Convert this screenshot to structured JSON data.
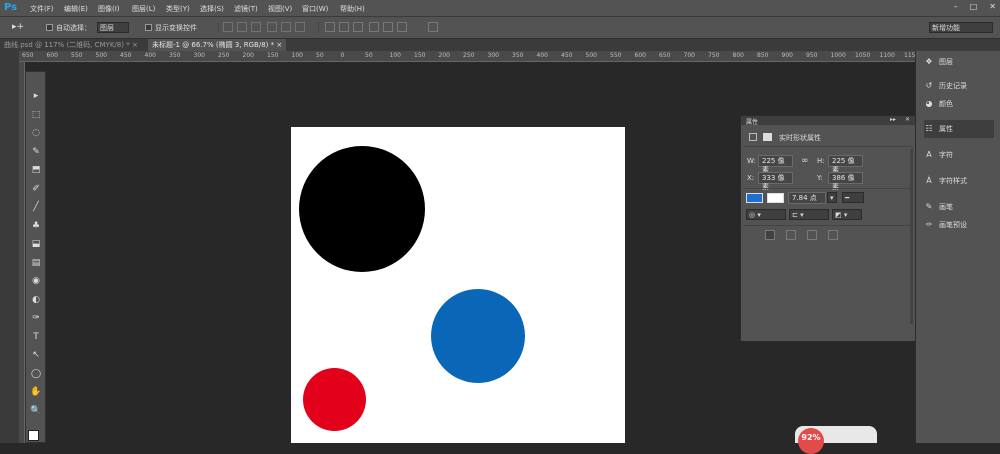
{
  "app": {
    "logo": "Ps"
  },
  "menu": [
    "文件(F)",
    "编辑(E)",
    "图像(I)",
    "图层(L)",
    "类型(Y)",
    "选择(S)",
    "滤镜(T)",
    "视图(V)",
    "窗口(W)",
    "帮助(H)"
  ],
  "window_controls": [
    "–",
    "□",
    "✕"
  ],
  "options": {
    "auto_select_label": "自动选择：",
    "auto_select_value": "图层",
    "show_transform_label": "显示变换控件",
    "workspace": "新增功能"
  },
  "tabs": [
    {
      "label": "曲线.psd @ 117% (二维码, CMYK/8) *",
      "close": "×"
    },
    {
      "label": "未标题-1 @ 66.7% (椭圆 3, RGB/8) *",
      "close": "×"
    }
  ],
  "ruler_numbers": [
    "650",
    "600",
    "550",
    "500",
    "450",
    "400",
    "350",
    "300",
    "250",
    "200",
    "150",
    "100",
    "50",
    "0",
    "50",
    "100",
    "150",
    "200",
    "250",
    "300",
    "350",
    "400",
    "450",
    "500",
    "550",
    "600",
    "650",
    "700",
    "750",
    "800",
    "850",
    "900",
    "950",
    "1000",
    "1050",
    "1100",
    "1150"
  ],
  "tools": [
    "▸",
    "⬚",
    "◌",
    "✎",
    "⬒",
    "✐",
    "╱",
    "♣",
    "⬓",
    "▤",
    "◉",
    "◐",
    "✑",
    "T",
    "↖",
    "◯",
    "✋",
    "🔍"
  ],
  "properties": {
    "title": "属性",
    "subtitle": "实时形状属性",
    "w_label": "W:",
    "w_value": "225 像素",
    "h_label": "H:",
    "h_value": "225 像素",
    "link_icon": "∞",
    "x_label": "X:",
    "x_value": "333 像素",
    "y_label": "Y:",
    "y_value": "386 像素",
    "stroke_size": "7.84 点",
    "fill_color": "#1f6fd1"
  },
  "docks": [
    {
      "icon": "❖",
      "label": "图层"
    },
    {
      "icon": "↺",
      "label": "历史记录"
    },
    {
      "icon": "◕",
      "label": "颜色"
    },
    {
      "icon": "☷",
      "label": "属性"
    },
    {
      "icon": "A",
      "label": "字符"
    },
    {
      "icon": "Ȧ",
      "label": "字符样式"
    },
    {
      "icon": "✎",
      "label": "画笔"
    },
    {
      "icon": "✑",
      "label": "画笔预设"
    }
  ],
  "shapes": {
    "black": "#000000",
    "blue": "#0a66b6",
    "red": "#e3001b"
  },
  "badge": {
    "percent": "92%"
  }
}
